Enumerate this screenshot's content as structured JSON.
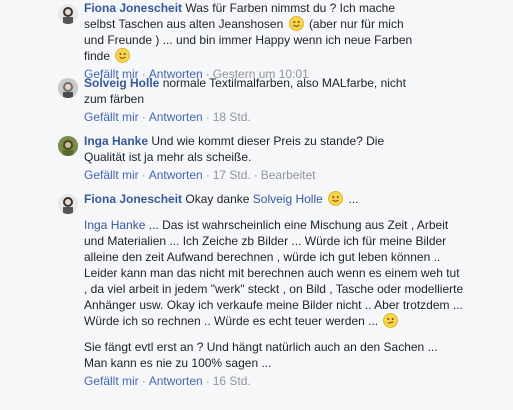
{
  "comments": [
    {
      "author": "Fiona Jonescheit",
      "text_1": "Was für Farben nimmst du ? Ich mache selbst Taschen aus alten Jeanshosen",
      "text_2": "(aber nur für mich und Freunde ) ... und bin immer Happy wenn ich neue Farben finde",
      "like_label": "Gefällt mir",
      "reply_label": "Antworten",
      "time": "Gestern um 10:01"
    },
    {
      "author": "Solveig Holle",
      "text": "normale Textilmalfarben, also MALfarbe, nicht zum färben",
      "like_label": "Gefällt mir",
      "reply_label": "Antworten",
      "time": "18 Std."
    },
    {
      "author": "Inga Hanke",
      "text": "Und wie kommt dieser Preis zu stande? Die Qualität ist ja mehr als scheiße.",
      "like_label": "Gefällt mir",
      "reply_label": "Antworten",
      "time": "17 Std.",
      "edited": "Bearbeitet"
    },
    {
      "author": "Fiona Jonescheit",
      "intro": "Okay danke",
      "intro_mention": "Solveig Holle",
      "intro_tail": "...",
      "mention": "Inga Hanke",
      "para_1": "... Das ist wahrscheinlich eine Mischung aus Zeit , Arbeit und Materialien ... Ich Zeiche zb Bilder ... Würde ich für meine Bilder alleine den zeit Aufwand berechnen , würde ich gut leben können .. Leider kann man das nicht mit berechnen auch wenn es einem weh tut , da viel arbeit in jedem \"werk\" steckt , on Bild , Tasche oder modellierte Anhänger usw. Okay ich verkaufe meine Bilder nicht .. Aber trotzdem ... Würde ich so rechnen .. Würde es echt teuer werden ...",
      "para_2": "Sie fängt evtl erst an ? Und hängt natürlich auch an den Sachen ... Man kann es nie zu 100% sagen ...",
      "like_label": "Gefällt mir",
      "reply_label": "Antworten",
      "time": "16 Std."
    }
  ],
  "emojis": [
    "smile-emoji",
    "smile-emoji",
    "smile-emoji",
    "confused-emoji"
  ],
  "colors": {
    "link": "#365899",
    "action": "#4267b2",
    "meta": "#90949c",
    "background": "#f6f7f9"
  }
}
